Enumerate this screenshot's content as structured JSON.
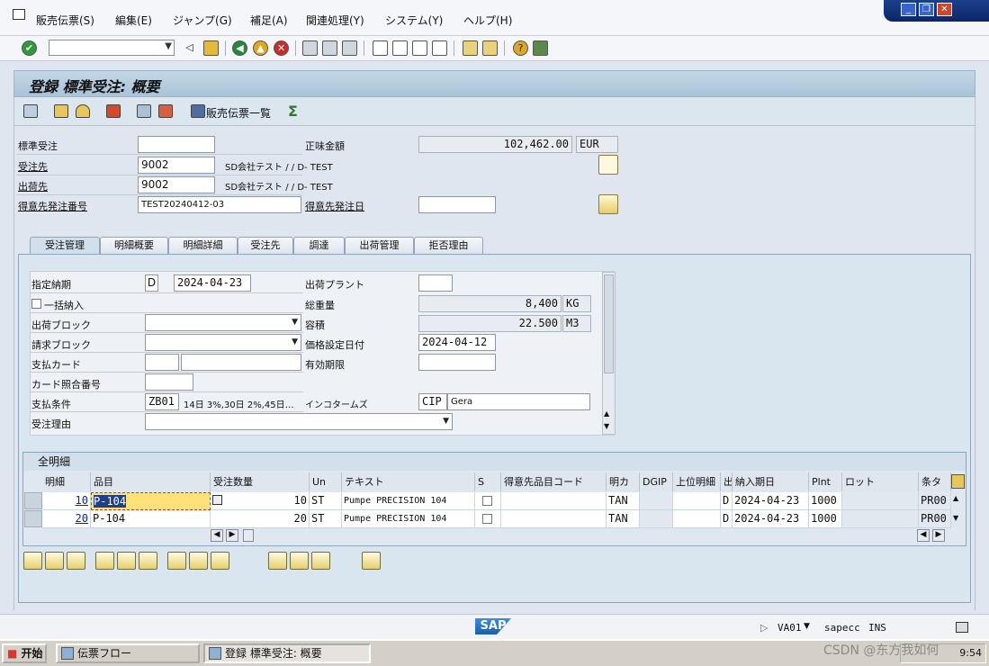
{
  "menu": {
    "items": [
      "販売伝票(S)",
      "編集(E)",
      "ジャンプ(G)",
      "補足(A)",
      "関連処理(Y)",
      "システム(Y)",
      "ヘルプ(H)"
    ]
  },
  "title": "登録 標準受注: 概要",
  "app_toolbar": {
    "list_button": "販売伝票一覧"
  },
  "header": {
    "order_label": "標準受注",
    "order_value": "",
    "net_label": "正味金額",
    "net_value": "102,462.00",
    "currency": "EUR",
    "soldto_label": "受注先",
    "soldto_value": "9002",
    "soldto_name": "SD会社テスト / / D- TEST",
    "shipto_label": "出荷先",
    "shipto_value": "9002",
    "shipto_name": "SD会社テスト / / D- TEST",
    "po_label": "得意先発注番号",
    "po_value": "TEST20240412-03",
    "podate_label": "得意先発注日",
    "podate_value": ""
  },
  "tabs": [
    "受注管理",
    "明細概要",
    "明細詳細",
    "受注先",
    "調達",
    "出荷管理",
    "拒否理由"
  ],
  "order_mgmt": {
    "deliv_date_label": "指定納期",
    "deliv_date_type": "D",
    "deliv_date": "2024-04-23",
    "plant_label": "出荷プラント",
    "plant_value": "",
    "complete_label": "一括納入",
    "weight_label": "総重量",
    "weight_value": "8,400",
    "weight_unit": "KG",
    "shipblock_label": "出荷ブロック",
    "volume_label": "容積",
    "volume_value": "22.500",
    "volume_unit": "M3",
    "billblock_label": "請求ブロック",
    "pricedate_label": "価格設定日付",
    "pricedate_value": "2024-04-12",
    "paycard_label": "支払カード",
    "validto_label": "有効期限",
    "cardref_label": "カード照合番号",
    "payterms_label": "支払条件",
    "payterms_value": "ZB01",
    "payterms_text": "14日 3%,30日 2%,45日…",
    "incoterms_label": "インコタームズ",
    "incoterms_value": "CIP",
    "incoterms_text": "Gera",
    "reason_label": "受注理由"
  },
  "items_table": {
    "title": "全明細",
    "headers": [
      "明細",
      "品目",
      "受注数量",
      "Un",
      "テキスト",
      "S",
      "得意先品目コード",
      "明カ",
      "DGIP",
      "上位明細",
      "出",
      "納入期日",
      "Plnt",
      "ロット",
      "条タ"
    ],
    "rows": [
      {
        "item": "10",
        "material": "P-104",
        "qty": "10",
        "unit": "ST",
        "text": "Pumpe PRECISION 104",
        "cat": "TAN",
        "d": "D",
        "date": "2024-04-23",
        "plant": "1000",
        "cond": "PR00"
      },
      {
        "item": "20",
        "material": "P-104",
        "qty": "20",
        "unit": "ST",
        "text": "Pumpe PRECISION 104",
        "cat": "TAN",
        "d": "D",
        "date": "2024-04-23",
        "plant": "1000",
        "cond": "PR00"
      }
    ]
  },
  "status": {
    "tcode": "VA01",
    "server": "sapecc",
    "mode": "INS",
    "logo": "SAP"
  },
  "taskbar": {
    "start": "开始",
    "task1": "伝票フロー",
    "task2": "登録 標準受注: 概要",
    "clock": "9:54"
  },
  "watermark": "CSDN @东方我如何"
}
